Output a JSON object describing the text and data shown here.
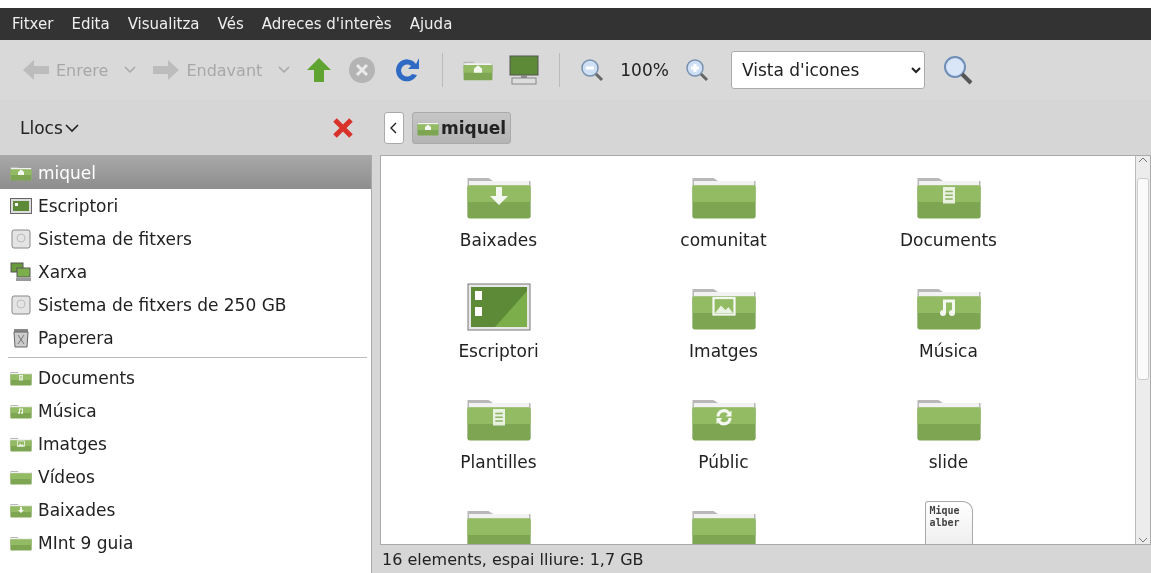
{
  "menu": [
    {
      "label": "Fitxer"
    },
    {
      "label": "Edita"
    },
    {
      "label": "Visualitza"
    },
    {
      "label": "Vés"
    },
    {
      "label": "Adreces d'interès"
    },
    {
      "label": "Ajuda"
    }
  ],
  "toolbar": {
    "back": {
      "label": "Enrere",
      "disabled": true
    },
    "forward": {
      "label": "Endavant",
      "disabled": true
    },
    "up": {
      "disabled": false
    },
    "stop": {
      "disabled": true
    },
    "reload": {
      "disabled": false
    },
    "zoom": "100%",
    "view_mode": "Vista d'icones"
  },
  "sidebar": {
    "title": "Llocs",
    "places": [
      {
        "label": "miquel",
        "kind": "home",
        "selected": true
      },
      {
        "label": "Escriptori",
        "kind": "desktop",
        "selected": false
      },
      {
        "label": "Sistema de fitxers",
        "kind": "drive",
        "selected": false
      },
      {
        "label": "Xarxa",
        "kind": "network",
        "selected": false
      },
      {
        "label": "Sistema de fitxers de 250 GB",
        "kind": "drive",
        "selected": false
      },
      {
        "label": "Paperera",
        "kind": "trash",
        "selected": false
      }
    ],
    "bookmarks": [
      {
        "label": "Documents",
        "kind": "documents",
        "selected": false
      },
      {
        "label": "Música",
        "kind": "music",
        "selected": false
      },
      {
        "label": "Imatges",
        "kind": "pictures",
        "selected": false
      },
      {
        "label": "Vídeos",
        "kind": "folder",
        "selected": false
      },
      {
        "label": "Baixades",
        "kind": "downloads",
        "selected": false
      },
      {
        "label": "MInt 9 guia",
        "kind": "folder",
        "selected": false
      }
    ]
  },
  "pathbar": {
    "crumbs": [
      {
        "label": "miquel",
        "selected": true
      }
    ]
  },
  "files": [
    {
      "label": "Baixades",
      "kind": "downloads"
    },
    {
      "label": "comunitat",
      "kind": "folder"
    },
    {
      "label": "Documents",
      "kind": "documents"
    },
    {
      "label": "Escriptori",
      "kind": "desktop"
    },
    {
      "label": "Imatges",
      "kind": "pictures"
    },
    {
      "label": "Música",
      "kind": "music"
    },
    {
      "label": "Plantilles",
      "kind": "documents"
    },
    {
      "label": "Públic",
      "kind": "sync"
    },
    {
      "label": "slide",
      "kind": "folder"
    },
    {
      "kind": "folder"
    },
    {
      "kind": "folder"
    },
    {
      "kind": "text",
      "preview": [
        "Mique",
        "alber"
      ]
    }
  ],
  "status_bar": "16 elements, espai lliure: 1,7 GB"
}
